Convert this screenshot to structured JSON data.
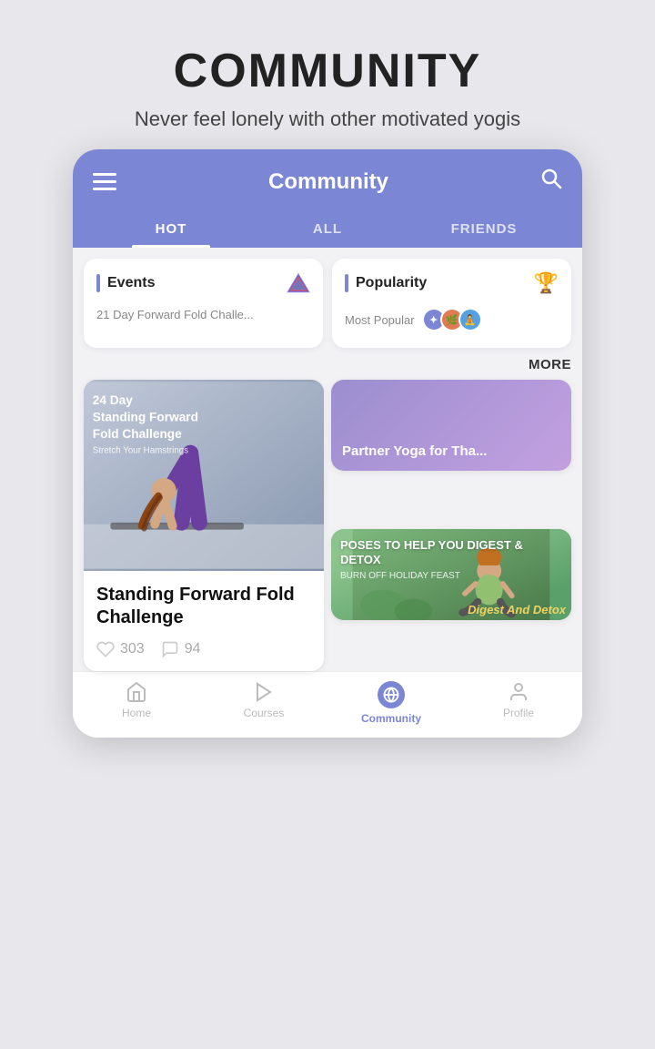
{
  "header": {
    "title": "COMMUNITY",
    "subtitle": "Never feel lonely with other motivated yogis"
  },
  "appbar": {
    "title": "Community",
    "menu_icon": "hamburger",
    "search_icon": "search"
  },
  "tabs": [
    {
      "label": "HOT",
      "active": true
    },
    {
      "label": "ALL",
      "active": false
    },
    {
      "label": "FRIENDS",
      "active": false
    }
  ],
  "cards": [
    {
      "id": "events",
      "label": "Events",
      "icon": "vmark",
      "sub": "21 Day Forward Fold Challe..."
    },
    {
      "id": "popularity",
      "label": "Popularity",
      "icon": "trophy",
      "sub": "Most Popular"
    }
  ],
  "more_label": "MORE",
  "featured": [
    {
      "id": "standing-forward-fold",
      "title": "24 Day Standing Forward Fold Challenge",
      "subtitle": "Stretch Your Hamstrings",
      "likes": "303",
      "comments": "94",
      "image_type": "yoga_pose"
    },
    {
      "id": "partner-yoga",
      "title": "Partner Yoga for Tha...",
      "image_type": "purple_banner"
    },
    {
      "id": "digest-detox",
      "title": "POSES TO HELP YOU DIGEST & DETOX",
      "subtitle": "BURN OFF HOLIDAY FEAST",
      "watermark": "Digest And Detox",
      "image_type": "green_nature"
    }
  ],
  "bottom_nav": [
    {
      "id": "home",
      "label": "Home",
      "icon": "home",
      "active": false
    },
    {
      "id": "courses",
      "label": "Courses",
      "icon": "play",
      "active": false
    },
    {
      "id": "community",
      "label": "Community",
      "icon": "globe",
      "active": true
    },
    {
      "id": "profile",
      "label": "Profile",
      "icon": "person",
      "active": false
    }
  ],
  "card_title_main": "Standing Forward Fold Challenge",
  "likes_count": "303",
  "comments_count": "94"
}
